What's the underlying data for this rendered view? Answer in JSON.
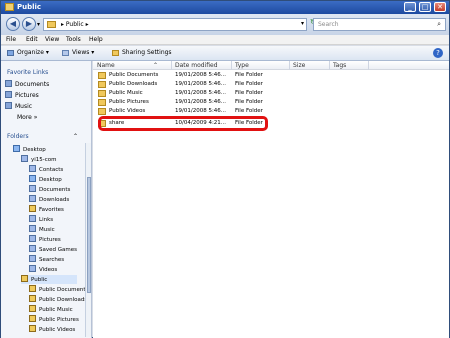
{
  "title": "Public",
  "window_controls": {
    "minimize": "_",
    "maximize": "□",
    "close": "✕"
  },
  "nav": {
    "back": "◀",
    "forward": "▶",
    "dropdown": "▾"
  },
  "address": {
    "path": "▸ Public ▸",
    "dropdown": "▾"
  },
  "search": {
    "placeholder": "Search",
    "icon": "⌕"
  },
  "menu": {
    "file": "File",
    "edit": "Edit",
    "view": "View",
    "tools": "Tools",
    "help": "Help"
  },
  "toolbar": {
    "organize": "Organize",
    "views": "Views",
    "sharing": "Sharing Settings",
    "dropdown": "▾",
    "help": "?"
  },
  "sidebar": {
    "favorite_title": "Favorite Links",
    "favorites": [
      "Documents",
      "Pictures",
      "Music"
    ],
    "more": "More »",
    "folders_title": "Folders",
    "folders_chevron": "⌃",
    "tree": [
      "Desktop",
      "yi15-com",
      "Contacts",
      "Desktop",
      "Documents",
      "Downloads",
      "Favorites",
      "Links",
      "Music",
      "Pictures",
      "Saved Games",
      "Searches",
      "Videos",
      "Public",
      "Public Document",
      "Public Downloads",
      "Public Music",
      "Public Pictures",
      "Public Videos"
    ]
  },
  "columns": [
    "Name",
    "Date modified",
    "Type",
    "Size",
    "Tags"
  ],
  "files": [
    {
      "name": "Public Documents",
      "date": "19/01/2008 5:46...",
      "type": "File Folder"
    },
    {
      "name": "Public Downloads",
      "date": "19/01/2008 5:46...",
      "type": "File Folder"
    },
    {
      "name": "Public Music",
      "date": "19/01/2008 5:46...",
      "type": "File Folder"
    },
    {
      "name": "Public Pictures",
      "date": "19/01/2008 5:46...",
      "type": "File Folder"
    },
    {
      "name": "Public Videos",
      "date": "19/01/2008 5:46...",
      "type": "File Folder"
    },
    {
      "name": "share",
      "date": "10/04/2009 4:21...",
      "type": "File Folder"
    }
  ],
  "colors": {
    "highlight": "#e11111",
    "title_bar": "#2c5db4"
  }
}
